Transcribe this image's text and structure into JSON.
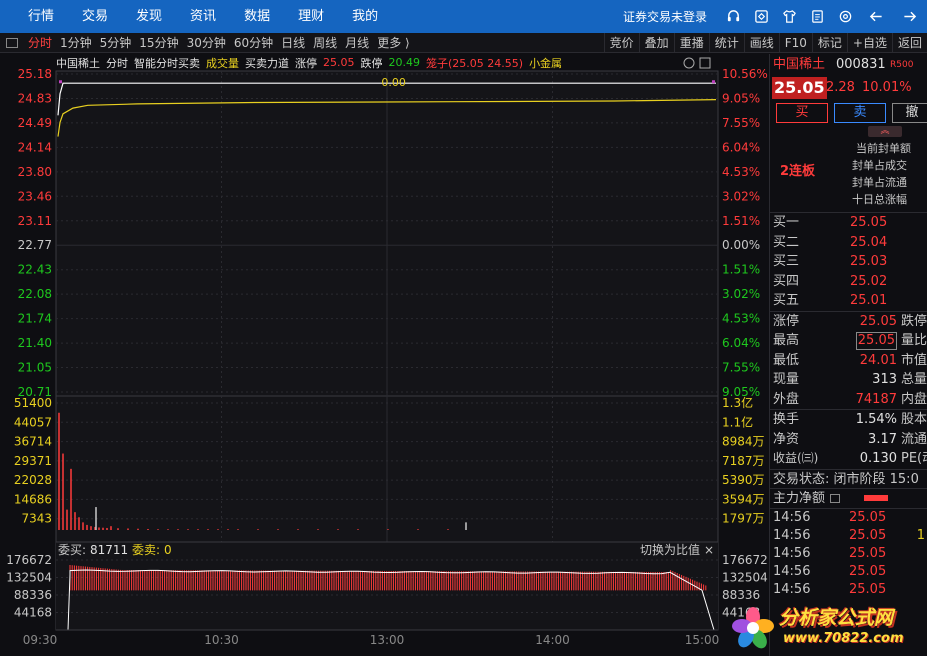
{
  "nav": {
    "items": [
      "行情",
      "交易",
      "发现",
      "资讯",
      "数据",
      "理财",
      "我的"
    ],
    "login": "证券交易未登录"
  },
  "toolbar": {
    "periods": [
      "分时",
      "1分钟",
      "5分钟",
      "15分钟",
      "30分钟",
      "60分钟",
      "日线",
      "周线",
      "月线",
      "更多 ⟩"
    ],
    "active_period": "分时",
    "right": [
      "竞价",
      "叠加",
      "重播",
      "统计",
      "画线",
      "F10",
      "标记",
      "+自选",
      "返回"
    ]
  },
  "chart_header": {
    "name": "中国稀土",
    "mode": "分时",
    "smart": "智能分时买卖",
    "volume": "成交量",
    "force": "买卖力道",
    "limit_up_label": "涨停",
    "limit_up": "25.05",
    "limit_down_label": "跌停",
    "limit_down": "20.49",
    "bid_ask": "笼子(25.05 24.55)",
    "sector": "小金属"
  },
  "center_label": "0.00",
  "lower_header": {
    "buy_label": "委买:",
    "buy_val": "81711",
    "sell_label": "委卖:",
    "sell_val": "0",
    "switch": "切换为比值",
    "close": "×"
  },
  "chart_data": [
    {
      "type": "line",
      "title": "分时",
      "price_ticks": [
        "25.18",
        "24.83",
        "24.49",
        "24.14",
        "23.80",
        "23.46",
        "23.11",
        "22.77",
        "22.43",
        "22.08",
        "21.74",
        "21.40",
        "21.05",
        "20.71"
      ],
      "pct_ticks": [
        "10.56%",
        "9.05%",
        "7.55%",
        "6.04%",
        "4.53%",
        "3.02%",
        "1.51%",
        "0.00%",
        "1.51%",
        "3.02%",
        "4.53%",
        "6.04%",
        "7.55%",
        "9.05%"
      ],
      "ylim": [
        20.71,
        25.18
      ],
      "prev_close": 22.77,
      "series": [
        {
          "values": [
            24.6,
            24.9,
            25.05,
            25.05,
            25.05,
            25.05,
            25.05,
            25.05,
            25.05,
            25.05
          ]
        },
        {
          "values": [
            24.3,
            24.5,
            24.62,
            24.7,
            24.74,
            24.76,
            24.78,
            24.79,
            24.8,
            24.82
          ]
        }
      ]
    },
    {
      "type": "bar",
      "title": "成交量",
      "vol_ticks": [
        "51400",
        "44057",
        "36714",
        "29371",
        "22028",
        "14686",
        "7343"
      ],
      "amt_ticks": [
        "1.3亿",
        "1.1亿",
        "8984万",
        "7187万",
        "5390万",
        "3594万",
        "1797万"
      ],
      "ylim": [
        0,
        51400
      ],
      "values": [
        46000,
        30000,
        8000,
        24000,
        7000,
        5000,
        3000,
        2000,
        1500,
        1200,
        1000,
        900,
        800,
        1500,
        9000,
        700,
        600,
        500,
        400,
        300,
        300,
        300,
        300,
        300,
        300,
        300,
        300,
        300,
        3000,
        300,
        300,
        300,
        300,
        300,
        300,
        300,
        300,
        300
      ]
    },
    {
      "type": "bar",
      "title": "委买",
      "ticks": [
        "176672",
        "132504",
        "88336",
        "44168"
      ],
      "ylim": [
        0,
        176672
      ],
      "x_ticks": [
        "09:30",
        "10:30",
        "13:00",
        "14:00",
        "15:00"
      ]
    }
  ],
  "rpanel": {
    "name": "中国稀土",
    "code": "000831",
    "tag": "R500",
    "price": "25.05",
    "change": "2.28",
    "pct": "10.01%",
    "buy_btn": "买",
    "sell_btn": "卖",
    "more_btn": "撤",
    "lianban": "2连板",
    "info": [
      "当前封单额",
      "封单占成交",
      "封单占流通",
      "十日总涨幅"
    ],
    "bids": [
      {
        "label": "买一",
        "price": "25.05"
      },
      {
        "label": "买二",
        "price": "25.04"
      },
      {
        "label": "买三",
        "price": "25.03"
      },
      {
        "label": "买四",
        "price": "25.02"
      },
      {
        "label": "买五",
        "price": "25.01"
      }
    ],
    "stats1": [
      {
        "label": "涨停",
        "val": "25.05",
        "extra": "跌停"
      },
      {
        "label": "最高",
        "val": "25.05",
        "extra": "量比"
      },
      {
        "label": "最低",
        "val": "24.01",
        "extra": "市值"
      },
      {
        "label": "现量",
        "val": "313",
        "extra": "总量"
      },
      {
        "label": "外盘",
        "val": "74187",
        "extra": "内盘"
      }
    ],
    "stats2": [
      {
        "label": "换手",
        "val": "1.54%",
        "extra": "股本"
      },
      {
        "label": "净资",
        "val": "3.17",
        "extra": "流通"
      },
      {
        "label": "收益(㈢)",
        "val": "0.130",
        "extra": "PE(动"
      }
    ],
    "status": "交易状态: 闭市阶段 15:0",
    "net_label": "主力净额",
    "ticks": [
      {
        "time": "14:56",
        "price": "25.05",
        "extra": ""
      },
      {
        "time": "14:56",
        "price": "25.05",
        "extra": "1"
      },
      {
        "time": "14:56",
        "price": "25.05",
        "extra": ""
      },
      {
        "time": "14:56",
        "price": "25.05",
        "extra": ""
      },
      {
        "time": "14:56",
        "price": "25.05",
        "extra": ""
      }
    ]
  },
  "logo": {
    "name": "分析家公式网",
    "url": "www.70822.com"
  }
}
